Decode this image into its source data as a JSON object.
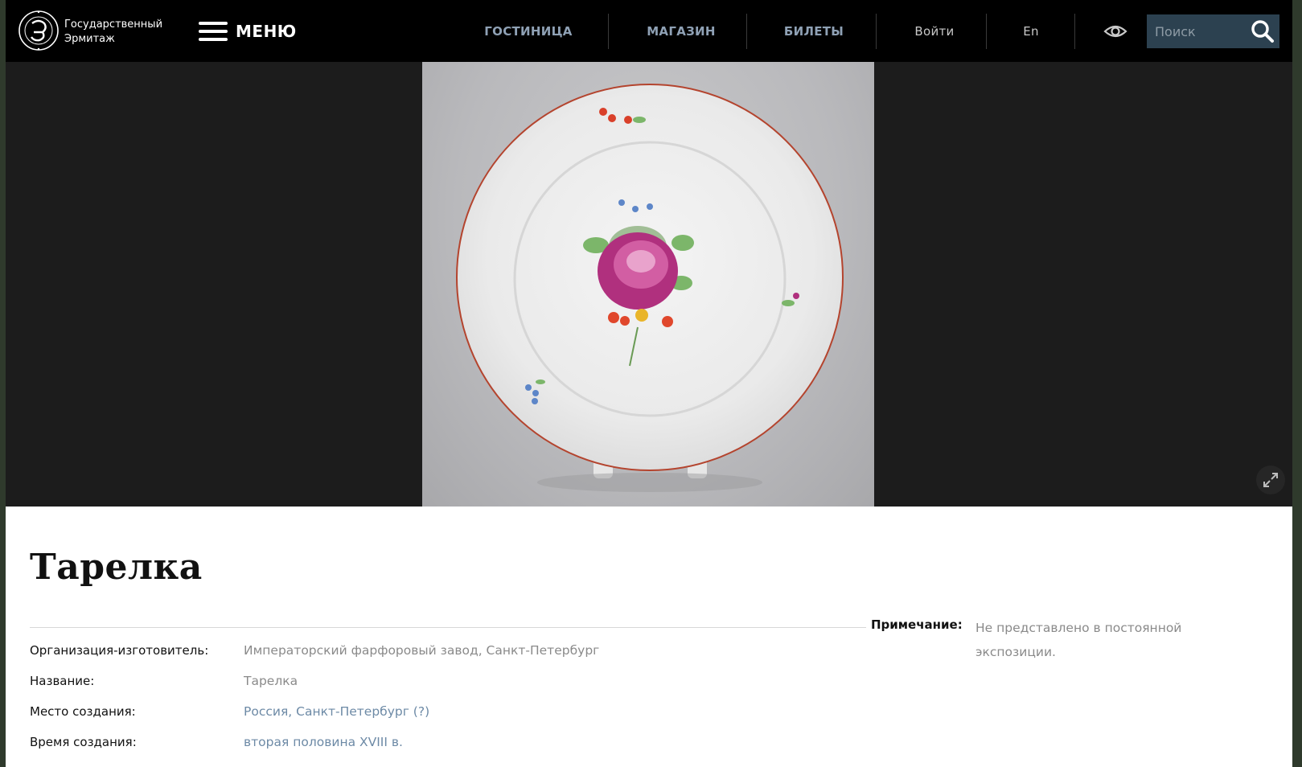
{
  "header": {
    "logo_text_line1": "Государственный",
    "logo_text_line2": "Эрмитаж",
    "menu_label": "МЕНЮ",
    "nav": [
      {
        "label": "ГОСТИНИЦА"
      },
      {
        "label": "МАГАЗИН"
      },
      {
        "label": "БИЛЕТЫ"
      },
      {
        "label": "Войти"
      },
      {
        "label": "En"
      }
    ],
    "search_placeholder": "Поиск",
    "icons": [
      "hermitage-logo-icon",
      "hamburger-icon",
      "eye-icon",
      "search-icon",
      "expand-icon"
    ]
  },
  "item": {
    "title": "Тарелка",
    "fields": [
      {
        "label": "Организация-изготовитель:",
        "value": "Императорский фарфоровый завод, Санкт-Петербург"
      },
      {
        "label": "Название:",
        "value": "Тарелка"
      },
      {
        "label": "Место создания:",
        "value": "Россия, Санкт-Петербург (?)"
      },
      {
        "label": "Время создания:",
        "value": "вторая половина XVIII в."
      }
    ],
    "note_label": "Примечание:",
    "note_value": "Не представлено в постоянной экспозиции."
  },
  "colors": {
    "header_bg": "#000000",
    "nav_accent": "#8fa1b5",
    "search_bg": "#2c4150",
    "hero_bg": "#1c1c1c",
    "link": "#6d8aa6"
  }
}
